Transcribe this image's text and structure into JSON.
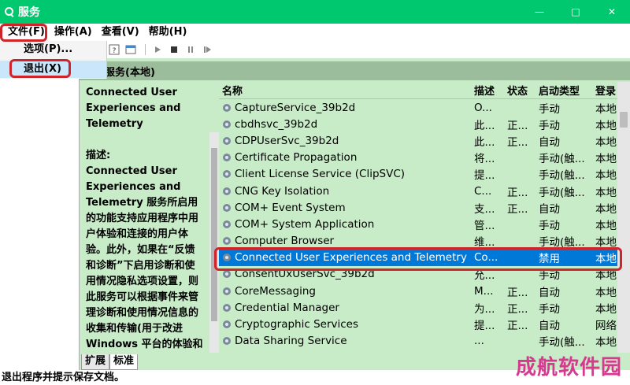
{
  "window": {
    "title": "服务",
    "minimize": "—",
    "maximize": "□",
    "close": "✕"
  },
  "menubar": [
    "文件(F)",
    "操作(A)",
    "查看(V)",
    "帮助(H)"
  ],
  "file_menu": {
    "items": [
      "选项(P)...",
      "退出(X)"
    ]
  },
  "services_header": {
    "title": "服务(本地)"
  },
  "description": {
    "service_title": "Connected User Experiences and Telemetry",
    "label": "描述:",
    "text": "Connected User Experiences and Telemetry 服务所启用的功能支持应用程序中用户体验和连接的用户体验。此外，如果在“反馈和诊断”下启用诊断和使用情况隐私选项设置，则此服务可以根据事件来管理诊断和使用情况信息的收集和传输(用于改进Windows 平台的体验和"
  },
  "columns": [
    "名称",
    "描述",
    "状态",
    "启动类型",
    "登录"
  ],
  "services": [
    {
      "name": "CaptureService_39b2d",
      "desc": "O...",
      "status": "",
      "start": "手动",
      "logon": "本地..."
    },
    {
      "name": "cbdhsvc_39b2d",
      "desc": "此...",
      "status": "正...",
      "start": "手动",
      "logon": "本地..."
    },
    {
      "name": "CDPUserSvc_39b2d",
      "desc": "此...",
      "status": "正...",
      "start": "自动",
      "logon": "本地..."
    },
    {
      "name": "Certificate Propagation",
      "desc": "将...",
      "status": "",
      "start": "手动(触...",
      "logon": "本地..."
    },
    {
      "name": "Client License Service (ClipSVC)",
      "desc": "提...",
      "status": "",
      "start": "手动(触...",
      "logon": "本地..."
    },
    {
      "name": "CNG Key Isolation",
      "desc": "C...",
      "status": "正...",
      "start": "手动(触...",
      "logon": "本地..."
    },
    {
      "name": "COM+ Event System",
      "desc": "支...",
      "status": "正...",
      "start": "自动",
      "logon": "本地..."
    },
    {
      "name": "COM+ System Application",
      "desc": "管...",
      "status": "",
      "start": "手动",
      "logon": "本地..."
    },
    {
      "name": "Computer Browser",
      "desc": "维...",
      "status": "",
      "start": "手动(触...",
      "logon": "本地..."
    },
    {
      "name": "Connected User Experiences and Telemetry",
      "desc": "Co...",
      "status": "",
      "start": "禁用",
      "logon": "本地...",
      "selected": true
    },
    {
      "name": "ConsentUxUserSvc_39b2d",
      "desc": "允...",
      "status": "",
      "start": "手动",
      "logon": "本地..."
    },
    {
      "name": "CoreMessaging",
      "desc": "M...",
      "status": "正...",
      "start": "自动",
      "logon": "本地..."
    },
    {
      "name": "Credential Manager",
      "desc": "为...",
      "status": "正...",
      "start": "手动",
      "logon": "本地..."
    },
    {
      "name": "Cryptographic Services",
      "desc": "提...",
      "status": "正...",
      "start": "自动",
      "logon": "网络..."
    },
    {
      "name": "Data Sharing Service",
      "desc": "...",
      "status": "",
      "start": "手动(触...",
      "logon": "本地..."
    }
  ],
  "tabs": [
    "扩展",
    "标准"
  ],
  "statusbar": {
    "text": "退出程序并提示保存文档。"
  },
  "watermark": "成航软件园",
  "colors": {
    "titlebar": "#00c86f",
    "panel_bg": "#c8ecc8",
    "selection": "#0078d7",
    "highlight_box": "#d0242b"
  }
}
